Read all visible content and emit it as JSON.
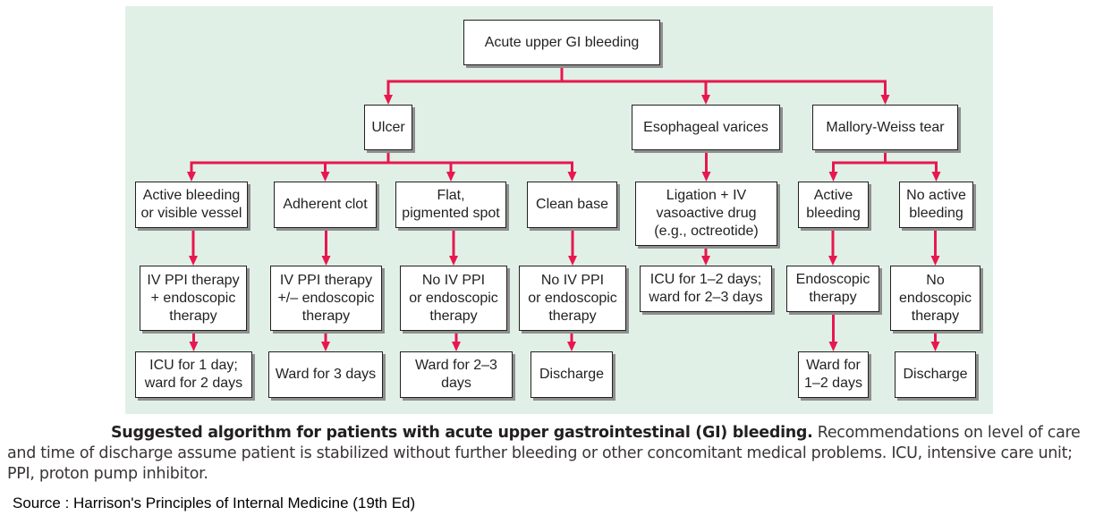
{
  "diagram": {
    "colors": {
      "background_panel": "#e1f0e6",
      "connector": "#e8174f",
      "box_border": "#231f20",
      "box_shadow": "#8d8f8e"
    },
    "nodes": {
      "root": "Acute upper GI bleeding",
      "ulcer": "Ulcer",
      "varices": "Esophageal varices",
      "mallory": "Mallory-Weiss tear",
      "u_active": "Active bleeding\nor visible vessel",
      "u_clot": "Adherent clot",
      "u_flat": "Flat,\npigmented spot",
      "u_clean": "Clean base",
      "v_ligation": "Ligation + IV\nvasoactive drug\n(e.g., octreotide)",
      "m_active": "Active\nbleeding",
      "m_noactive": "No active\nbleeding",
      "u_active_tx": "IV PPI therapy\n+ endoscopic\ntherapy",
      "u_clot_tx": "IV PPI therapy\n+/– endoscopic\ntherapy",
      "u_flat_tx": "No IV PPI\nor endoscopic\ntherapy",
      "u_clean_tx": "No IV PPI\nor endoscopic\ntherapy",
      "v_care": "ICU for 1–2 days;\nward for 2–3 days",
      "m_active_tx": "Endoscopic\ntherapy",
      "m_noactive_tx": "No\nendoscopic\ntherapy",
      "u_active_care": "ICU for 1 day;\nward for 2 days",
      "u_clot_care": "Ward for 3 days",
      "u_flat_care": "Ward for 2–3\ndays",
      "u_clean_care": "Discharge",
      "m_active_care": "Ward for\n1–2 days",
      "m_noactive_care": "Discharge"
    },
    "edges": [
      [
        "root",
        "ulcer"
      ],
      [
        "root",
        "varices"
      ],
      [
        "root",
        "mallory"
      ],
      [
        "ulcer",
        "u_active"
      ],
      [
        "ulcer",
        "u_clot"
      ],
      [
        "ulcer",
        "u_flat"
      ],
      [
        "ulcer",
        "u_clean"
      ],
      [
        "varices",
        "v_ligation"
      ],
      [
        "mallory",
        "m_active"
      ],
      [
        "mallory",
        "m_noactive"
      ],
      [
        "u_active",
        "u_active_tx"
      ],
      [
        "u_clot",
        "u_clot_tx"
      ],
      [
        "u_flat",
        "u_flat_tx"
      ],
      [
        "u_clean",
        "u_clean_tx"
      ],
      [
        "v_ligation",
        "v_care"
      ],
      [
        "m_active",
        "m_active_tx"
      ],
      [
        "m_noactive",
        "m_noactive_tx"
      ],
      [
        "u_active_tx",
        "u_active_care"
      ],
      [
        "u_clot_tx",
        "u_clot_care"
      ],
      [
        "u_flat_tx",
        "u_flat_care"
      ],
      [
        "u_clean_tx",
        "u_clean_care"
      ],
      [
        "m_active_tx",
        "m_active_care"
      ],
      [
        "m_noactive_tx",
        "m_noactive_care"
      ]
    ]
  },
  "caption": {
    "title": "Suggested algorithm for patients with acute upper gastrointestinal (GI) bleeding.",
    "body": " Recommendations on level of care and time of discharge assume patient is stabilized without further bleeding or other concomitant medical problems. ICU, intensive care unit; PPI, proton pump inhibitor."
  },
  "source": "Source : Harrison's Principles of Internal Medicine (19th Ed)"
}
